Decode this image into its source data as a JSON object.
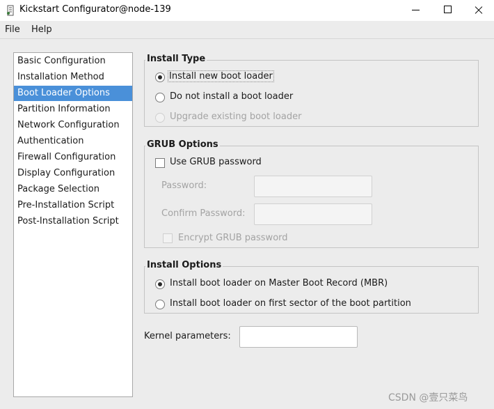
{
  "window": {
    "title": "Kickstart Configurator@node-139"
  },
  "menu": {
    "items": [
      "File",
      "Help"
    ]
  },
  "sidebar": {
    "items": [
      {
        "label": "Basic Configuration"
      },
      {
        "label": "Installation Method"
      },
      {
        "label": "Boot Loader Options",
        "selected": true
      },
      {
        "label": "Partition Information"
      },
      {
        "label": "Network Configuration"
      },
      {
        "label": "Authentication"
      },
      {
        "label": "Firewall Configuration"
      },
      {
        "label": "Display Configuration"
      },
      {
        "label": "Package Selection"
      },
      {
        "label": "Pre-Installation Script"
      },
      {
        "label": "Post-Installation Script"
      }
    ]
  },
  "install_type": {
    "title": "Install Type",
    "options": [
      {
        "label": "Install new boot loader",
        "checked": true,
        "enabled": true
      },
      {
        "label": "Do not install a boot loader",
        "checked": false,
        "enabled": true
      },
      {
        "label": "Upgrade existing boot loader",
        "checked": false,
        "enabled": false
      }
    ]
  },
  "grub_options": {
    "title": "GRUB Options",
    "use_password_label": "Use GRUB password",
    "password_label": "Password:",
    "password_value": "",
    "confirm_label": "Confirm Password:",
    "confirm_value": "",
    "encrypt_label": "Encrypt GRUB password"
  },
  "install_options": {
    "title": "Install Options",
    "options": [
      {
        "label": "Install boot loader on Master Boot Record (MBR)",
        "checked": true
      },
      {
        "label": "Install boot loader on first sector of the boot partition",
        "checked": false
      }
    ]
  },
  "kernel": {
    "label": "Kernel parameters:",
    "value": ""
  },
  "watermark": "CSDN @壹只菜鸟"
}
